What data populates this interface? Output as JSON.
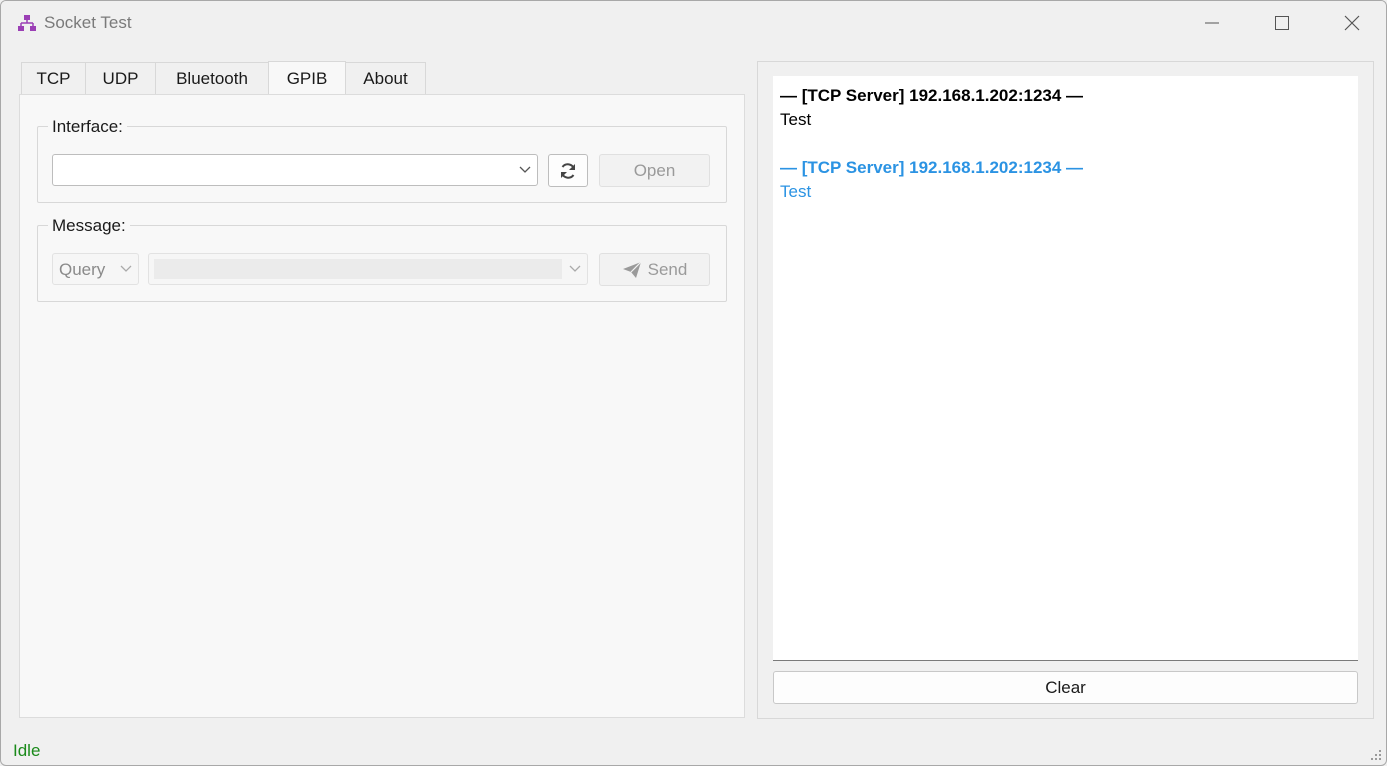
{
  "window": {
    "title": "Socket Test",
    "icon": "network-icon",
    "controls": [
      "minimize-icon",
      "maximize-icon",
      "close-icon"
    ]
  },
  "tabs": [
    {
      "label": "TCP",
      "active": false
    },
    {
      "label": "UDP",
      "active": false
    },
    {
      "label": "Bluetooth",
      "active": false
    },
    {
      "label": "GPIB",
      "active": true
    },
    {
      "label": "About",
      "active": false
    }
  ],
  "interface_group": {
    "title": "Interface:",
    "interface_value": "",
    "refresh_icon": "refresh-icon",
    "open_label": "Open"
  },
  "message_group": {
    "title": "Message:",
    "mode_value": "Query",
    "message_value": "",
    "send_icon": "paper-plane-icon",
    "send_label": "Send"
  },
  "log": {
    "entries": [
      {
        "header": "— [TCP Server] 192.168.1.202:1234 —",
        "body": "Test",
        "color": "#000000"
      },
      {
        "header": "— [TCP Server] 192.168.1.202:1234 —",
        "body": "Test",
        "color": "#2b93e3"
      }
    ],
    "clear_label": "Clear"
  },
  "status": {
    "text": "Idle",
    "color": "#1a8a1a"
  }
}
